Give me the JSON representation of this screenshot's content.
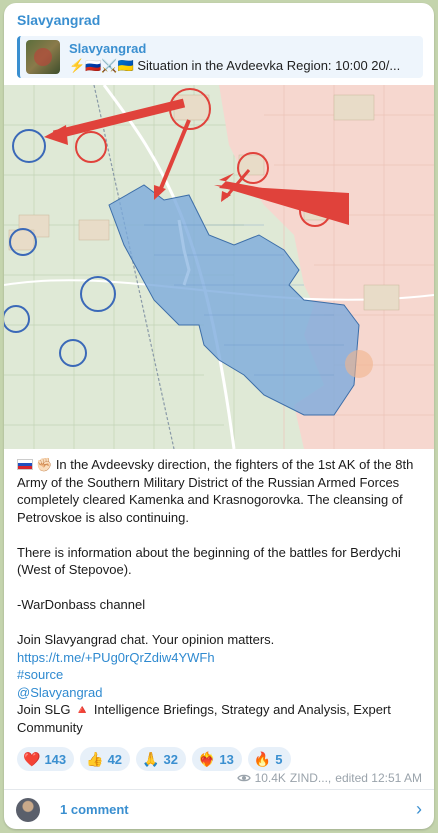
{
  "post": {
    "channel": "Slavyangrad",
    "reply": {
      "title": "Slavyangrad",
      "text": "⚡️🇷🇺⚔️🇺🇦 Situation in the Avdeevka Region: 10:00 20/..."
    },
    "body": {
      "p1": "In the Avdeevsky direction, the fighters of the 1st AK of the 8th Army of the Southern Military District of the Russian Armed Forces completely cleared Kamenka and Krasnogorovka. The cleansing of Petrovskoe is also continuing.",
      "p2": "There is information about the beginning of the battles for Berdychi (West of Stepovoe).",
      "p3": "-WarDonbass channel",
      "p4": "Join Slavyangrad chat. Your opinion matters.",
      "chat_link": "https://t.me/+PUg0rQrZdiw4YWFh",
      "hashtag": "#source",
      "mention": "@Slavyangrad",
      "p5": "Join SLG 🔺 Intelligence Briefings, Strategy and Analysis, Expert Community"
    },
    "reactions": [
      {
        "emoji": "❤️",
        "count": "143"
      },
      {
        "emoji": "👍",
        "count": "42"
      },
      {
        "emoji": "🙏",
        "count": "32"
      },
      {
        "emoji": "❤️‍🔥",
        "count": "13"
      },
      {
        "emoji": "🔥",
        "count": "5"
      }
    ],
    "meta": {
      "views": "10.4K",
      "author": "ZIND...,",
      "edited": "edited 12:51 AM"
    },
    "comments_label": "1 comment"
  },
  "colors": {
    "accent": "#3a8fd0",
    "russian_zone": "#f6d7cf",
    "ukrainian_zone": "#d8ead0",
    "contested": "#7aa9dc",
    "arrow": "#e0423b"
  }
}
